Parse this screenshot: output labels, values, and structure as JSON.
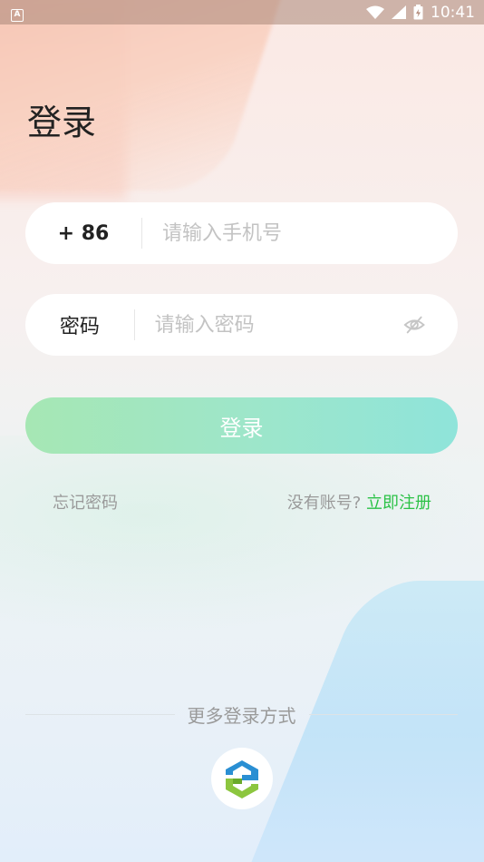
{
  "status_bar": {
    "notification_icon": "A",
    "time": "10:41"
  },
  "page": {
    "title": "登录"
  },
  "phone_field": {
    "country_code": "+ 86",
    "placeholder": "请输入手机号"
  },
  "password_field": {
    "label": "密码",
    "placeholder": "请输入密码"
  },
  "login_button": {
    "label": "登录"
  },
  "links": {
    "forgot_password": "忘记密码",
    "no_account": "没有账号?",
    "register": "立即注册"
  },
  "more_login": {
    "label": "更多登录方式"
  },
  "colors": {
    "accent_green": "#2cc247",
    "button_gradient_start": "#a6e7b4",
    "button_gradient_end": "#8fe4da"
  }
}
